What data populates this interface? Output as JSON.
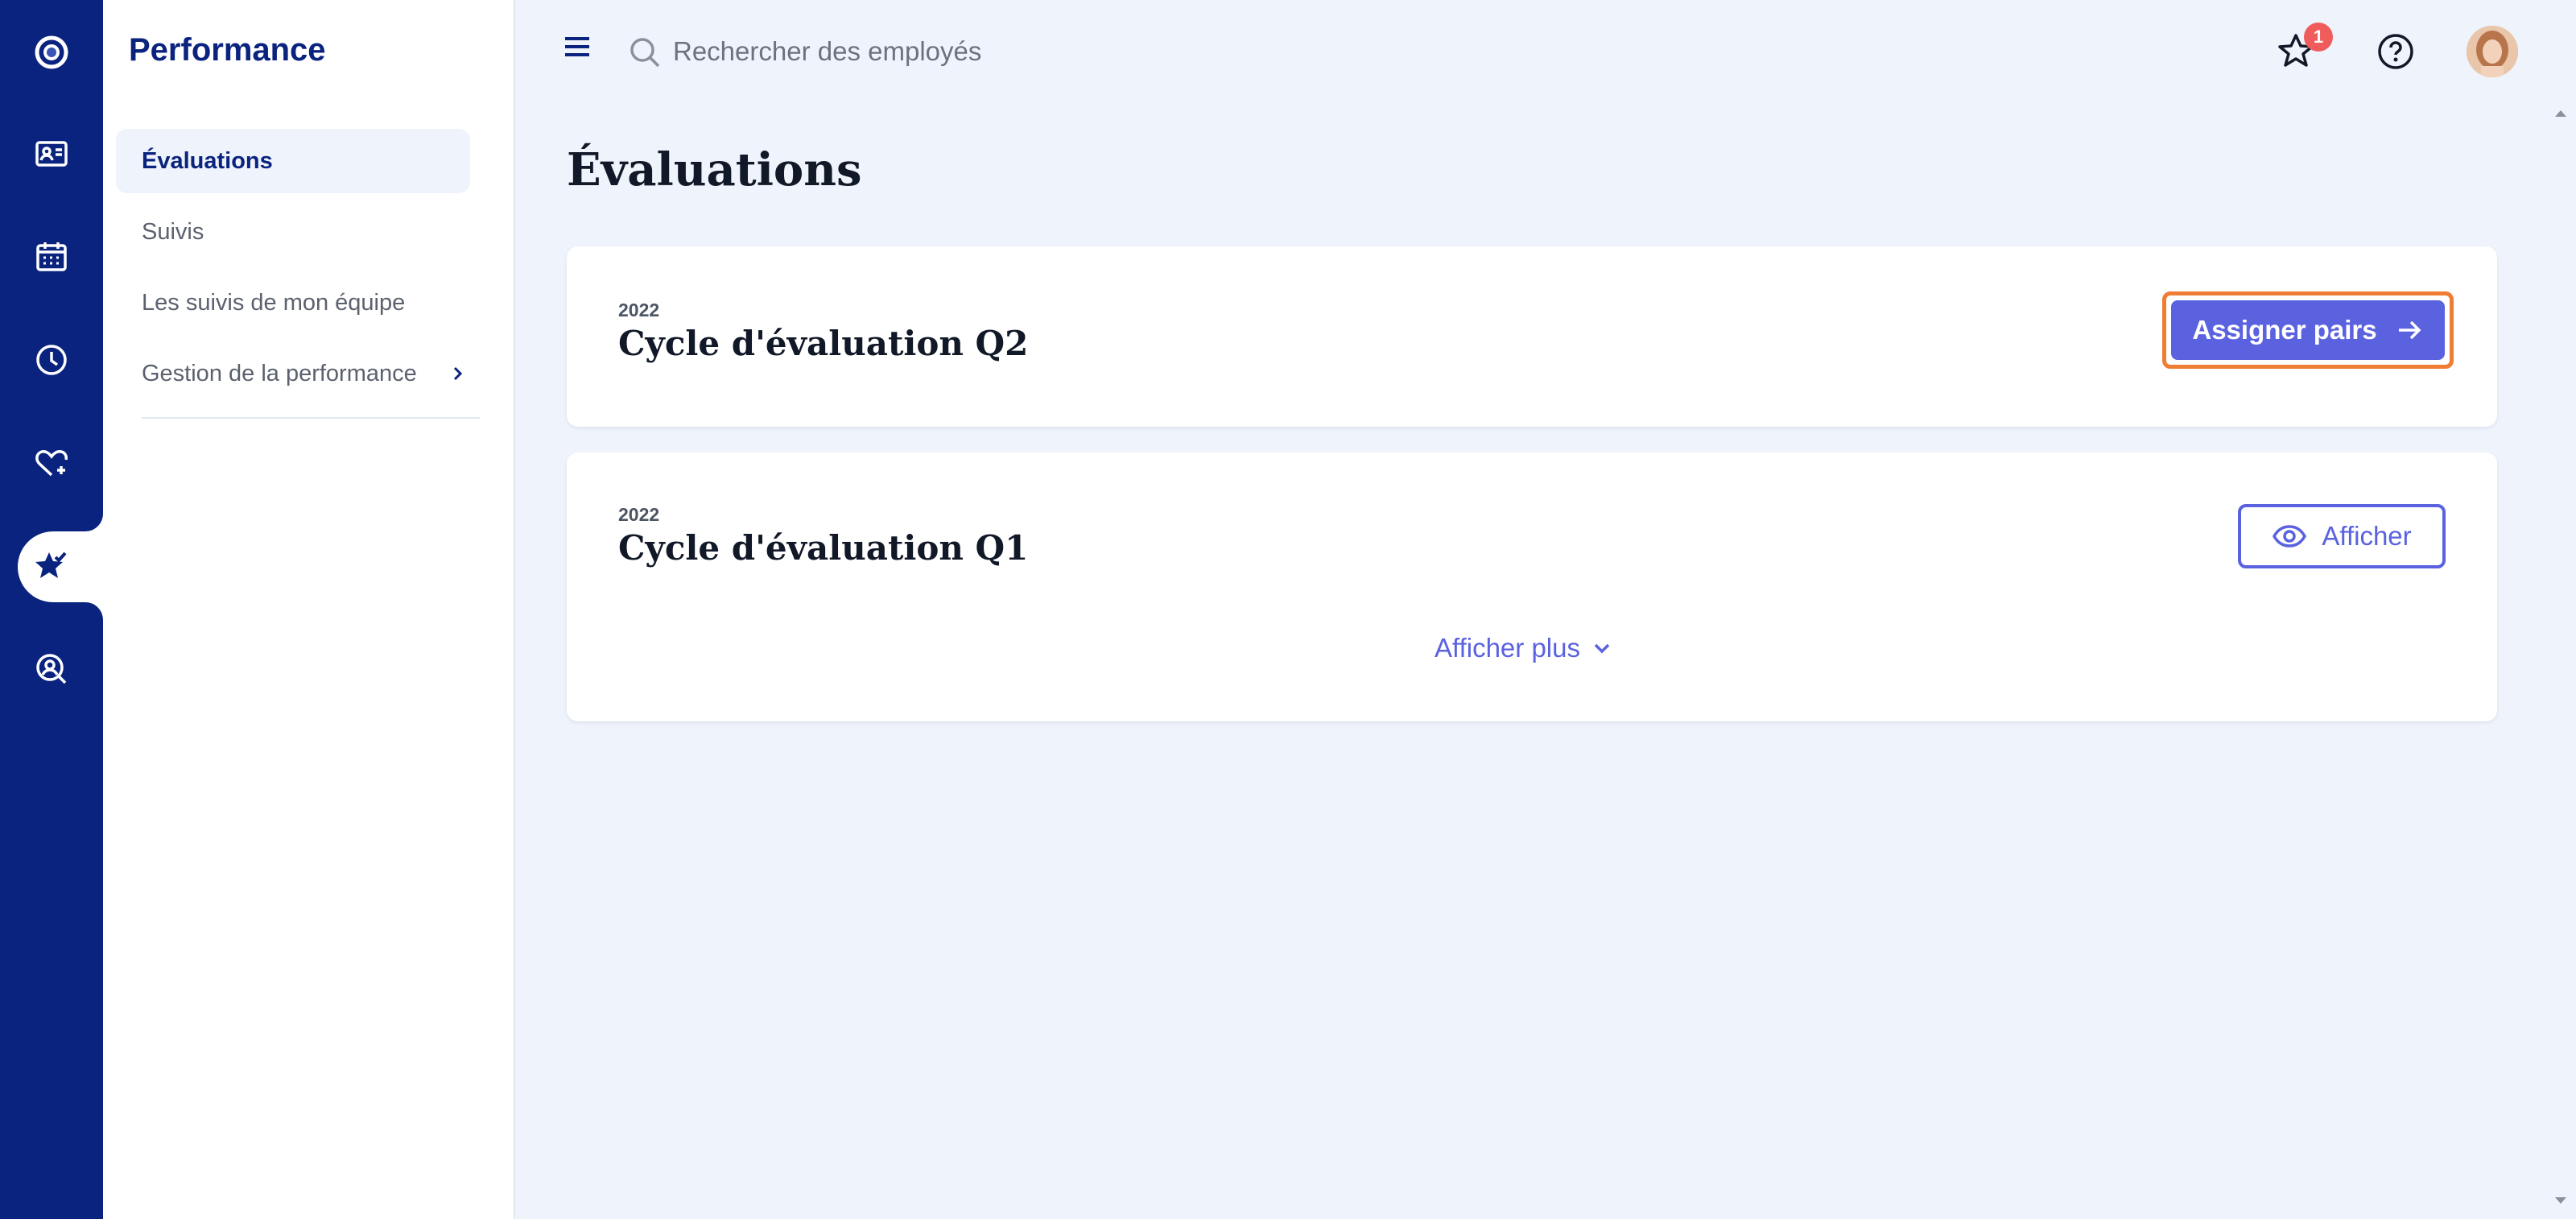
{
  "app": {
    "colors": {
      "brand": "#0a237f",
      "accent": "#5b62e0",
      "highlight": "#f07d34",
      "badge": "#f05b5b"
    }
  },
  "rail": {
    "items": [
      {
        "icon": "app-logo-icon"
      },
      {
        "icon": "id-card-icon"
      },
      {
        "icon": "calendar-icon"
      },
      {
        "icon": "clock-icon"
      },
      {
        "icon": "heart-plus-icon"
      },
      {
        "icon": "star-check-icon",
        "active": true
      },
      {
        "icon": "search-person-icon"
      }
    ]
  },
  "sidebar": {
    "title": "Performance",
    "items": [
      {
        "label": "Évaluations",
        "active": true
      },
      {
        "label": "Suivis"
      },
      {
        "label": "Les suivis de mon équipe"
      },
      {
        "label": "Gestion de la performance",
        "has_submenu": true
      }
    ]
  },
  "topbar": {
    "search_placeholder": "Rechercher des employés",
    "notification_count": "1"
  },
  "main": {
    "title": "Évaluations",
    "cycles": [
      {
        "year": "2022",
        "title": "Cycle d'évaluation Q2",
        "action_label": "Assigner pairs"
      },
      {
        "year": "2022",
        "title": "Cycle d'évaluation Q1",
        "action_label": "Afficher"
      }
    ],
    "show_more_label": "Afficher plus"
  }
}
